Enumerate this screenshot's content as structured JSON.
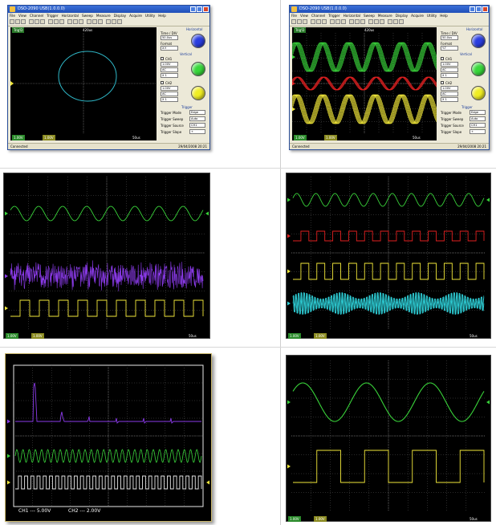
{
  "app": {
    "title": "DSO-2090 USB(1.0.0.0)",
    "menu": [
      "File",
      "View",
      "Channel",
      "Trigger",
      "Horizontal",
      "Sweep",
      "Measure",
      "Display",
      "Acquire",
      "Utility",
      "Help"
    ],
    "status_left": "Connected",
    "status_right": "29/04/2008  20:21"
  },
  "horizontal": {
    "header": "Horizontal",
    "timediv_label": "Time / DIV",
    "timediv_value": "50.0us",
    "format_label": "Format",
    "format_value": "Y-T",
    "format_xy": "X-Y"
  },
  "vertical": {
    "header": "Vertical",
    "ch1_label": "CH1",
    "ch1_volt": "1.00V",
    "ch1_coupling": "AC",
    "ch1_probe": "X 1",
    "ch2_label": "CH2",
    "ch2_volt": "1.00V",
    "ch2_coupling": "AC",
    "ch2_probe": "X 1"
  },
  "trigger": {
    "header": "Trigger",
    "mode_label": "Trigger Mode",
    "mode_value": "Edge",
    "sweep_label": "Trigger Sweep",
    "sweep_value": "Auto",
    "source_label": "Trigger Source",
    "source_value": "CH1",
    "slope_label": "Trigger Slope",
    "slope_value": "+"
  },
  "scope": {
    "ch1_readout": "1.00V",
    "ch2_readout": "1.00V",
    "timebase_readout": "50us",
    "trig_readout": "420us",
    "trigd": "Trig'D",
    "ch1_bottom": "CH1 ---  5.00V",
    "ch2_bottom": "CH2 ---  2.00V"
  },
  "colors": {
    "ch1": "#39d23a",
    "ch2": "#f2e83a",
    "ch3": "#e02020",
    "ch4": "#2fd0d8",
    "math": "#8a3ae8",
    "xy": "#2fb8c8",
    "knob_blue": "#2a3ee0",
    "knob_green": "#38d83a",
    "knob_yellow": "#f0ee22"
  }
}
